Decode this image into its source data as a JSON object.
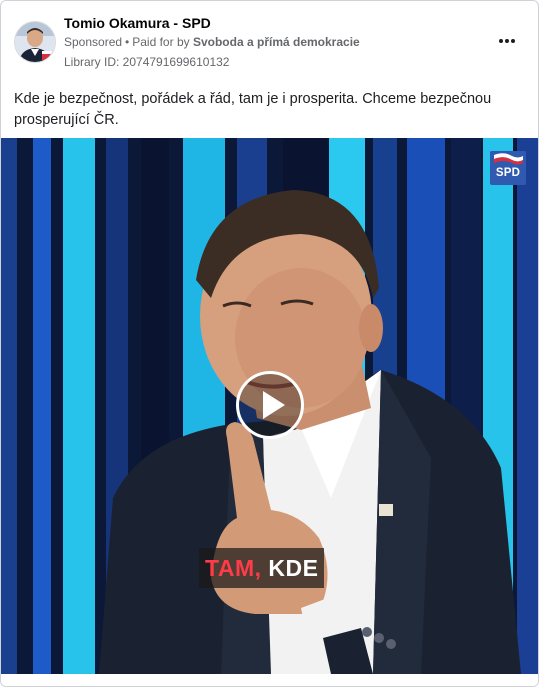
{
  "post": {
    "page_name": "Tomio Okamura - SPD",
    "sponsored_label": "Sponsored",
    "separator": "•",
    "paid_for_prefix": "Paid for by",
    "funder": "Svoboda a přímá demokracie",
    "library_id": "Library ID: 2074791699610132",
    "text": "Kde je bezpečnost, pořádek a řád, tam je i prosperita. Chceme bezpečnou prosperující ČR.",
    "more_icon": "more-horizontal-icon"
  },
  "video": {
    "logo_text": "SPD",
    "caption_highlight": "TAM,",
    "caption_rest": "KDE",
    "play_icon": "play-icon",
    "colors": {
      "background": "#0c1838",
      "stripe_cyan": "#27c3ea",
      "caption_red": "#ff3b4a"
    }
  }
}
